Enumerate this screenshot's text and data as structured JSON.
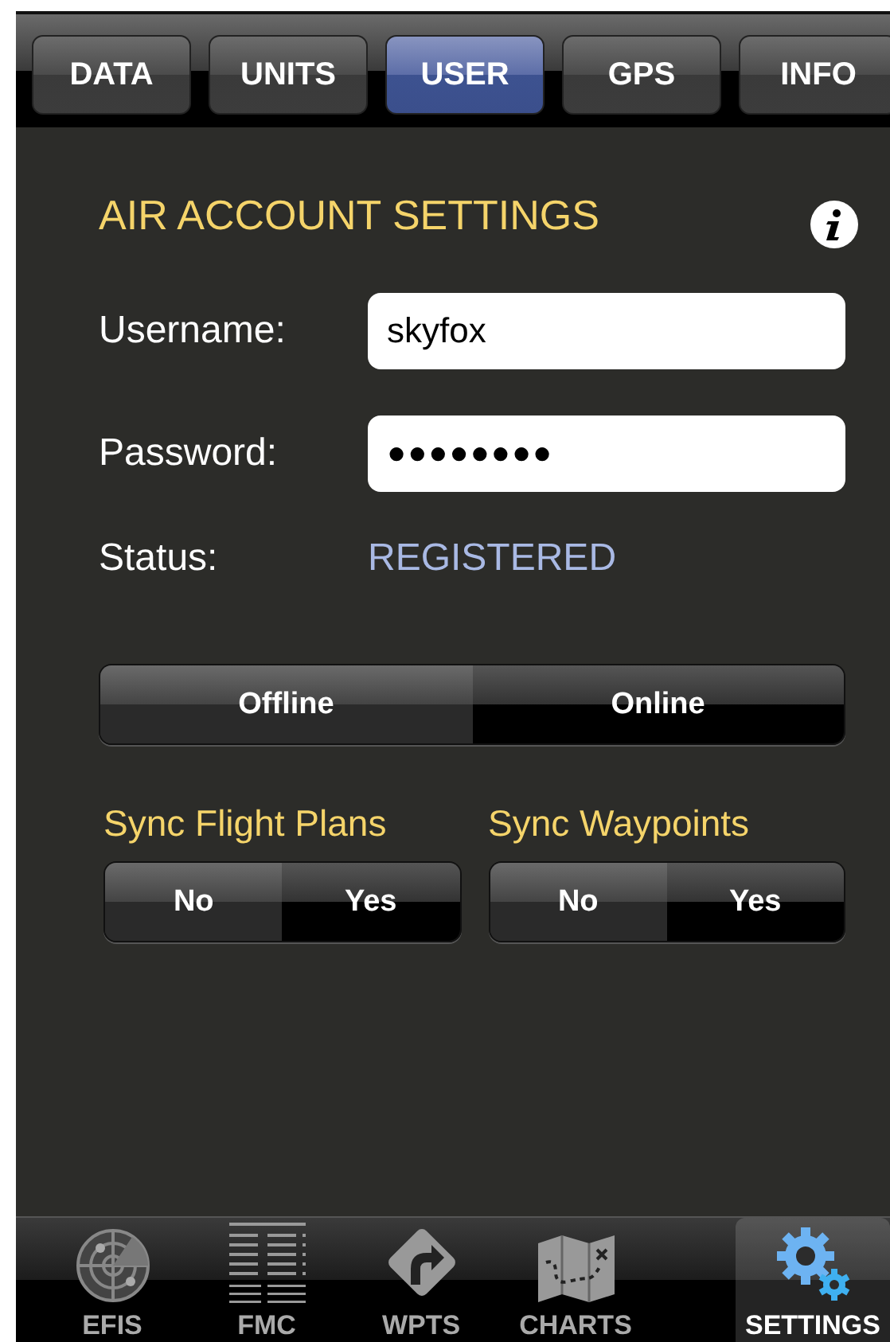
{
  "top_tabs": [
    {
      "label": "DATA",
      "selected": false
    },
    {
      "label": "UNITS",
      "selected": false
    },
    {
      "label": "USER",
      "selected": true
    },
    {
      "label": "GPS",
      "selected": false
    },
    {
      "label": "INFO",
      "selected": false
    }
  ],
  "title": "AIR ACCOUNT SETTINGS",
  "fields": [
    {
      "label": "Username:",
      "value": "skyfox"
    },
    {
      "label": "Password:",
      "value": "●●●●●●●●"
    }
  ],
  "status": {
    "label": "Status:",
    "value": "REGISTERED"
  },
  "connection": {
    "segments": [
      {
        "label": "Offline",
        "selected": false
      },
      {
        "label": "Online",
        "selected": true
      }
    ]
  },
  "sync": [
    {
      "label": "Sync Flight Plans",
      "segments": [
        {
          "label": "No",
          "selected": false
        },
        {
          "label": "Yes",
          "selected": true
        }
      ]
    },
    {
      "label": "Sync Waypoints",
      "segments": [
        {
          "label": "No",
          "selected": false
        },
        {
          "label": "Yes",
          "selected": true
        }
      ]
    }
  ],
  "bottom_tabs": [
    {
      "kind": "radar",
      "label": "EFIS",
      "selected": false
    },
    {
      "kind": "fmc",
      "label": "FMC",
      "selected": false
    },
    {
      "kind": "sign",
      "label": "WPTS",
      "selected": false
    },
    {
      "kind": "map",
      "label": "CHARTS",
      "selected": false
    },
    {
      "kind": "gears",
      "label": "SETTINGS",
      "selected": true
    }
  ]
}
